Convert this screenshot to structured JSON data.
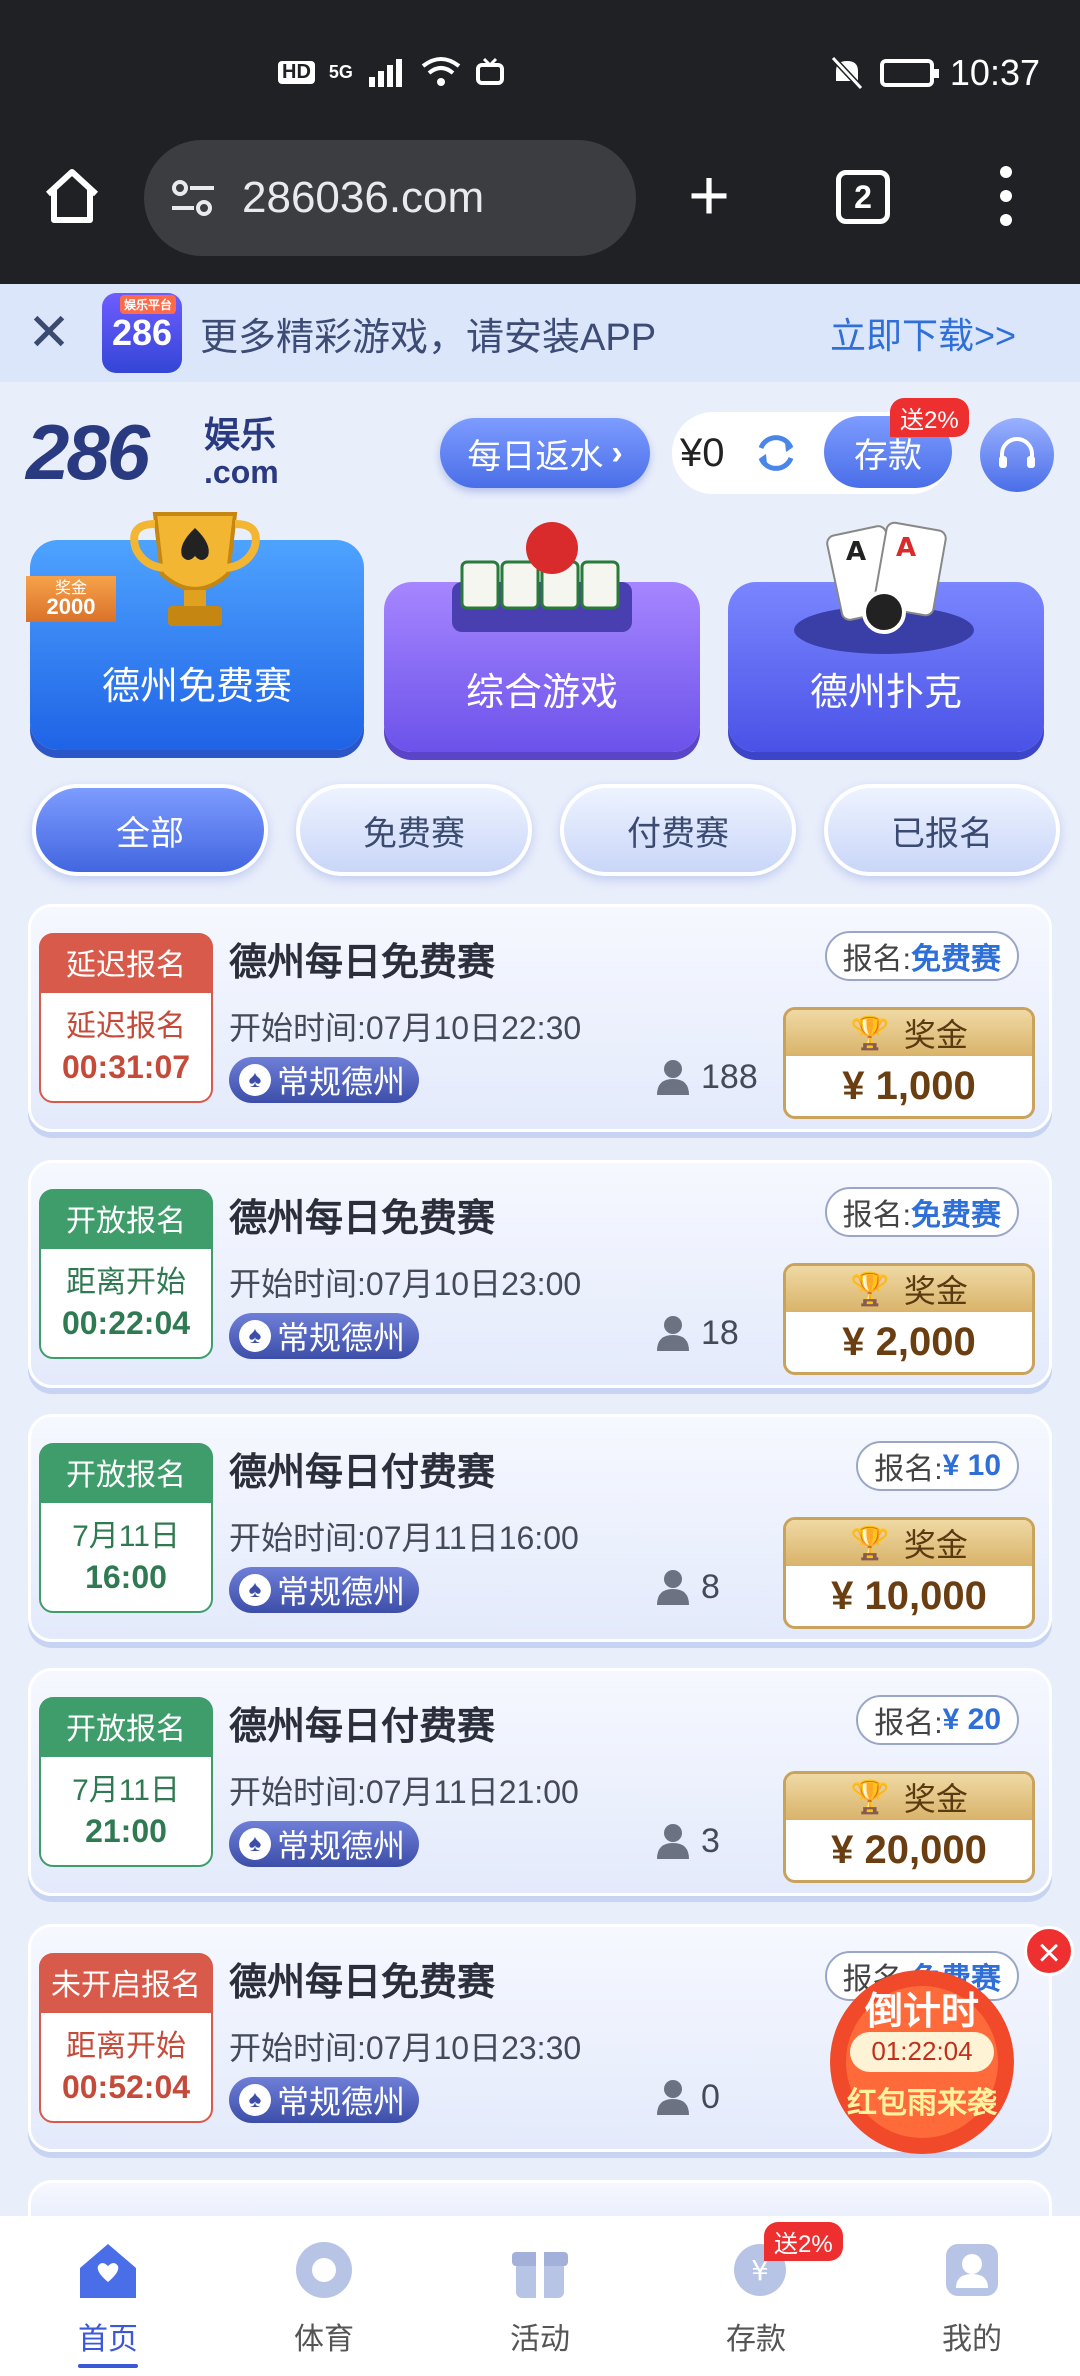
{
  "status_bar": {
    "hd": "HD",
    "net": "5G",
    "time": "10:37"
  },
  "browser": {
    "url": "286036.com",
    "tab_count": "2"
  },
  "install_banner": {
    "logo_tag": "娱乐平台",
    "logo_text": "286",
    "text": "更多精彩游戏，请安装APP",
    "link": "立即下载>>"
  },
  "header": {
    "logo_num": "286",
    "logo_sub": "娱乐",
    "logo_com": ".com",
    "rebate_label": "每日返水",
    "balance": "¥0",
    "deposit_label": "存款",
    "deposit_badge": "送2%"
  },
  "game_cards": {
    "free": {
      "label": "德州免费赛",
      "prize_tag_top": "奖金",
      "prize_tag_amount": "2000"
    },
    "comp": {
      "label": "综合游戏"
    },
    "poker": {
      "label": "德州扑克"
    }
  },
  "filters": [
    "全部",
    "免费赛",
    "付费赛",
    "已报名"
  ],
  "tournaments": [
    {
      "status": "延迟报名",
      "sub_top": "延迟报名",
      "sub_bottom": "00:31:07",
      "name": "德州每日免费赛",
      "start": "开始时间:07月10日22:30",
      "type": "常规德州",
      "signup_label": "报名:",
      "signup_value": "免费赛",
      "players": "188",
      "prize_label": "奖金",
      "prize": "¥ 1,000"
    },
    {
      "status": "开放报名",
      "sub_top": "距离开始",
      "sub_bottom": "00:22:04",
      "name": "德州每日免费赛",
      "start": "开始时间:07月10日23:00",
      "type": "常规德州",
      "signup_label": "报名:",
      "signup_value": "免费赛",
      "players": "18",
      "prize_label": "奖金",
      "prize": "¥ 2,000"
    },
    {
      "status": "开放报名",
      "sub_top": "7月11日",
      "sub_bottom": "16:00",
      "name": "德州每日付费赛",
      "start": "开始时间:07月11日16:00",
      "type": "常规德州",
      "signup_label": "报名:",
      "signup_value": "¥ 10",
      "players": "8",
      "prize_label": "奖金",
      "prize": "¥ 10,000"
    },
    {
      "status": "开放报名",
      "sub_top": "7月11日",
      "sub_bottom": "21:00",
      "name": "德州每日付费赛",
      "start": "开始时间:07月11日21:00",
      "type": "常规德州",
      "signup_label": "报名:",
      "signup_value": "¥ 20",
      "players": "3",
      "prize_label": "奖金",
      "prize": "¥ 20,000"
    },
    {
      "status": "未开启报名",
      "sub_top": "距离开始",
      "sub_bottom": "00:52:04",
      "name": "德州每日免费赛",
      "start": "开始时间:07月10日23:30",
      "type": "常规德州",
      "signup_label": "报名:",
      "signup_value": "免费赛",
      "players": "0",
      "prize_label": "",
      "prize": ""
    }
  ],
  "float_promo": {
    "title": "倒计时",
    "timer": "01:22:04",
    "subtitle": "红包雨来袭"
  },
  "bottom_nav": {
    "items": [
      "首页",
      "体育",
      "活动",
      "存款",
      "我的"
    ],
    "badge": "送2%"
  },
  "colors": {
    "accent": "#3a58d8",
    "red_status": "#d85a4a",
    "green_status": "#3f9d6c",
    "gold": "#c9a35c"
  }
}
